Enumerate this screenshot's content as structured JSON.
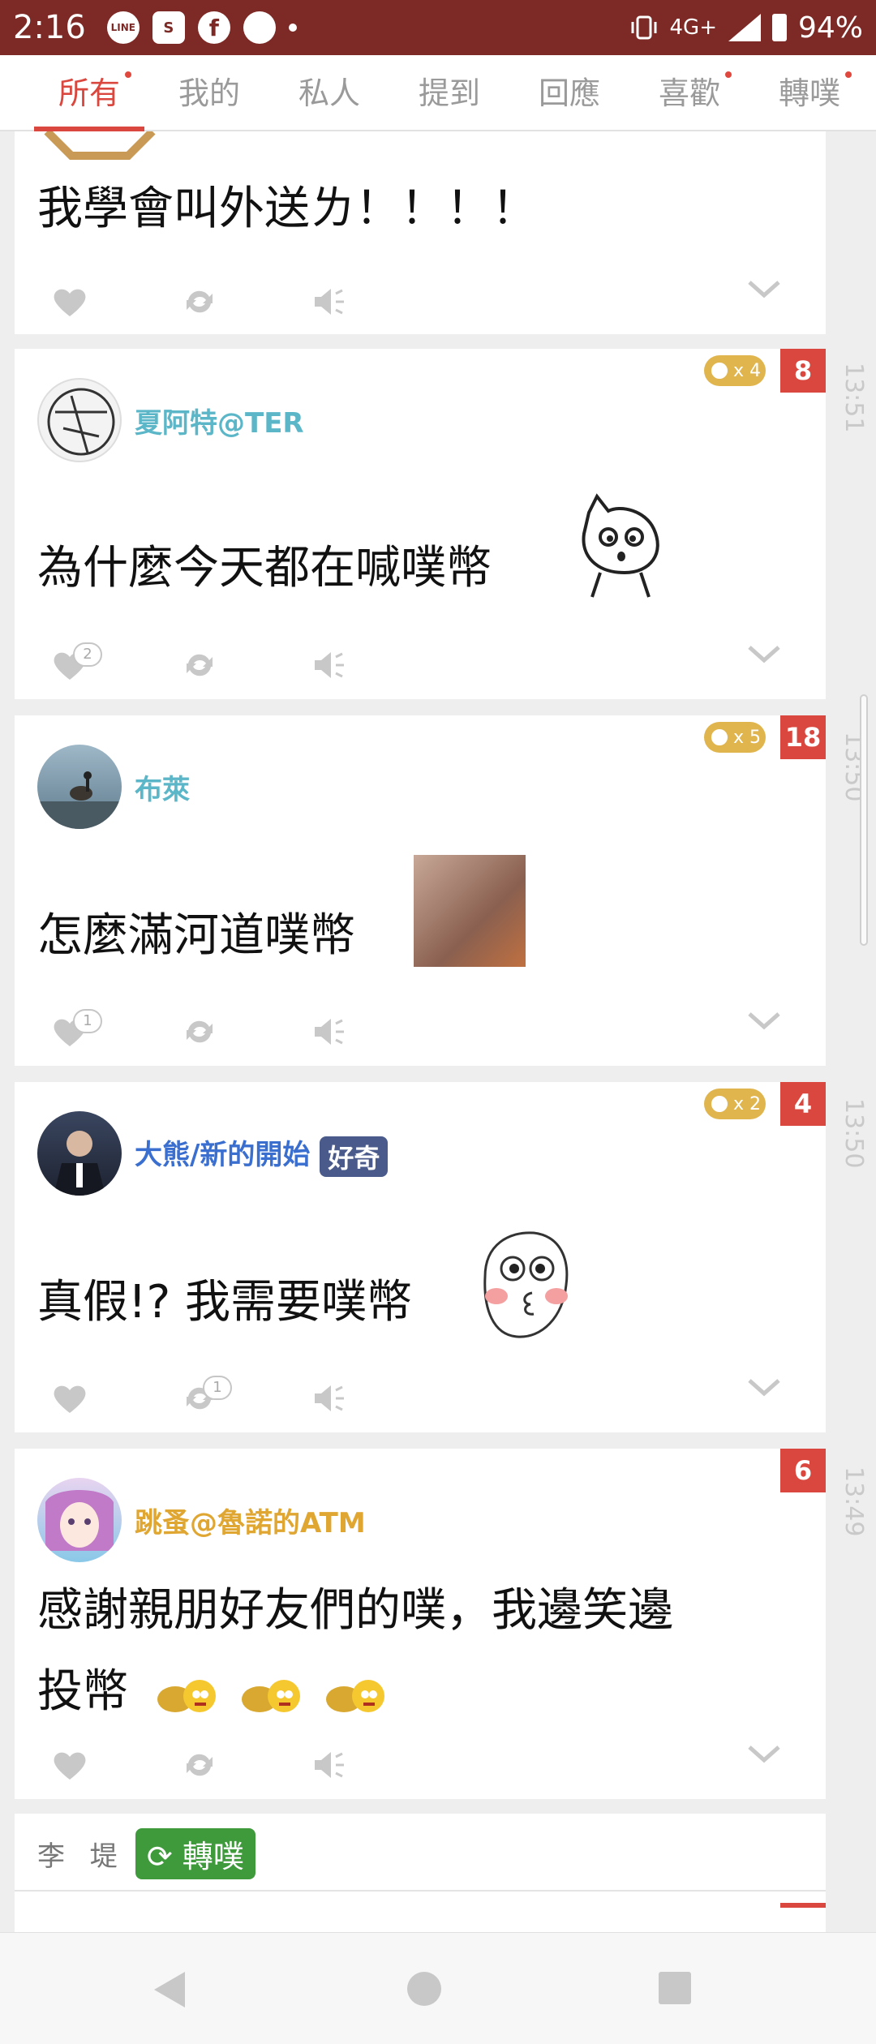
{
  "status_bar": {
    "time": "2:16",
    "network": "4G+",
    "battery": "94%",
    "notif_icons": [
      "LINE",
      "S",
      "f",
      "chat"
    ]
  },
  "tabs": [
    {
      "label": "所有",
      "active": true,
      "dot": true
    },
    {
      "label": "我的",
      "active": false,
      "dot": false
    },
    {
      "label": "私人",
      "active": false,
      "dot": false
    },
    {
      "label": "提到",
      "active": false,
      "dot": false
    },
    {
      "label": "回應",
      "active": false,
      "dot": false
    },
    {
      "label": "喜歡",
      "active": false,
      "dot": true
    },
    {
      "label": "轉噗",
      "active": false,
      "dot": true
    }
  ],
  "posts": [
    {
      "body": "我學會叫外送ㄌ！！！！"
    },
    {
      "author": "夏阿特@TER",
      "author_color": "#5bb6c8",
      "body": "為什麼今天都在喊噗幣",
      "coin": "x 4",
      "replies": "8",
      "likes": "2",
      "time": "13:51"
    },
    {
      "author": "布萊",
      "author_color": "#5bb6c8",
      "body": "怎麼滿河道噗幣",
      "coin": "x 5",
      "replies": "18",
      "likes": "1",
      "time": "13:50"
    },
    {
      "author": "大熊/新的開始",
      "author_color": "#3a6fd0",
      "tag": "好奇",
      "tag_color": "#4a5a8a",
      "body": "真假!? 我需要噗幣",
      "coin": "x 2",
      "replies": "4",
      "replurks": "1",
      "time": "13:50"
    },
    {
      "author": "跳蚤@魯諾的ATM",
      "author_color": "#e0a632",
      "body_line1": "感謝親朋好友們的噗，我邊笑邊",
      "body_line2": "投幣",
      "replies": "6",
      "time": "13:49"
    },
    {
      "author": "李 堤",
      "tag": "轉噗",
      "tag_color": "#3f9a3c"
    }
  ],
  "colors": {
    "accent": "#d9473e",
    "status_bar": "#7d2a26"
  }
}
